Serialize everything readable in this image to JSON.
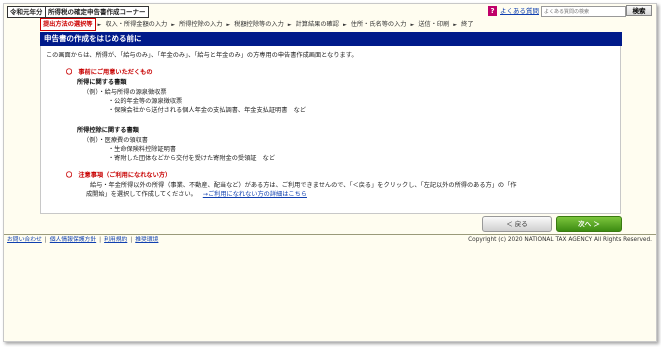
{
  "header": {
    "era_label": "令和元年分",
    "corner_title": "所得税の確定申告書作成コーナー",
    "faq_link": "よくある質問",
    "search_placeholder": "よくある質問の検索",
    "search_button": "検索"
  },
  "steps": [
    {
      "label": "提出方法の選択等",
      "current": true
    },
    {
      "label": "収入・所得金額の入力",
      "current": false
    },
    {
      "label": "所得控除の入力",
      "current": false
    },
    {
      "label": "税額控除等の入力",
      "current": false
    },
    {
      "label": "計算結果の確認",
      "current": false
    },
    {
      "label": "住所・氏名等の入力",
      "current": false
    },
    {
      "label": "送信・印刷",
      "current": false
    },
    {
      "label": "終了",
      "current": false
    }
  ],
  "page_title": "申告書の作成をはじめる前に",
  "intro": "この画面からは、所得が、「給与のみ」、「年金のみ」、「給与と年金のみ」の方専用の申告書作成画面となります。",
  "prep": {
    "heading": "〇　事前にご用意いただくもの",
    "income_heading": "所得に関する書類",
    "income_items": [
      "（例）・給与所得の源泉徴収票",
      "・公的年金等の源泉徴収票",
      "・保険会社から送付される個人年金の支払調書、年金支払証明書　など"
    ],
    "deduction_heading": "所得控除に関する書類",
    "deduction_items": [
      "（例）・医療費の領収書",
      "・生命保険料控除証明書",
      "・寄附した団体などから交付を受けた寄附金の受領証　など"
    ]
  },
  "notes": {
    "heading": "〇　注意事項（ご利用になれない方）",
    "line1": "給与・年金所得以外の所得（事業、不動産、配当など）がある方は、ご利用できませんので、「＜戻る」をクリックし、「左記以外の所得のある方」の「作",
    "line2": "成開始」を選択して作成してください。",
    "detail_link": "→ご利用になれない方の詳細はこちら"
  },
  "buttons": {
    "back": "＜ 戻る",
    "next": "次へ ＞"
  },
  "footer": {
    "links": [
      "お問い合わせ",
      "個人情報保護方針",
      "利用規約",
      "推奨環境"
    ],
    "copyright": "Copyright (c) 2020 NATIONAL TAX AGENCY All Rights Reserved."
  },
  "colors": {
    "title_bar": "#001a8a",
    "accent_red": "#c80000",
    "next_button": "#4c9a1e",
    "link": "#1040b0"
  }
}
